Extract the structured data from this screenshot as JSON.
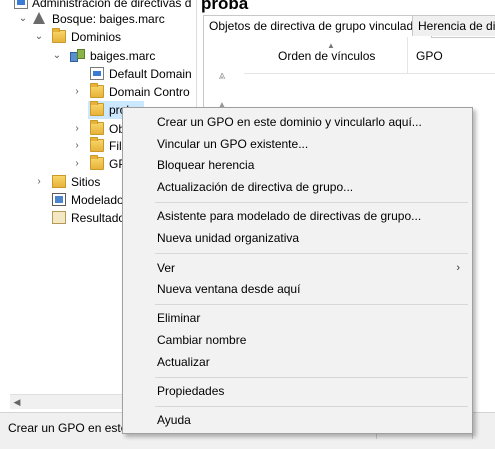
{
  "tree": {
    "root_label": "Administración de directivas d",
    "forest_label": "Bosque: baiges.marc",
    "domains_label": "Dominios",
    "domain_label": "baiges.marc",
    "default_policy_label": "Default Domain",
    "domain_controllers_label": "Domain Contro",
    "selected_ou_label": "proba",
    "ou2_label": "Ob",
    "ou3_label": "Fil",
    "ou4_label": "GP",
    "sites_label": "Sitios",
    "modeling_label": "Modelado",
    "results_label": "Resultado"
  },
  "right": {
    "title": "proba",
    "tabs": [
      "Objetos de directiva de grupo vinculados",
      "Herencia de direc"
    ],
    "columns": [
      "Orden de vínculos",
      "GPO"
    ]
  },
  "status": {
    "text": "Crear un GPO en este d"
  },
  "context_menu": {
    "group1": [
      "Crear un GPO en este dominio y vincularlo aquí...",
      "Vincular un GPO existente...",
      "Bloquear herencia",
      "Actualización de directiva de grupo..."
    ],
    "group2": [
      "Asistente para modelado de directivas de grupo...",
      "Nueva unidad organizativa"
    ],
    "group3": [
      "Ver",
      "Nueva ventana desde aquí"
    ],
    "group4": [
      "Eliminar",
      "Cambiar nombre",
      "Actualizar"
    ],
    "group5": [
      "Propiedades"
    ],
    "group6": [
      "Ayuda"
    ]
  }
}
